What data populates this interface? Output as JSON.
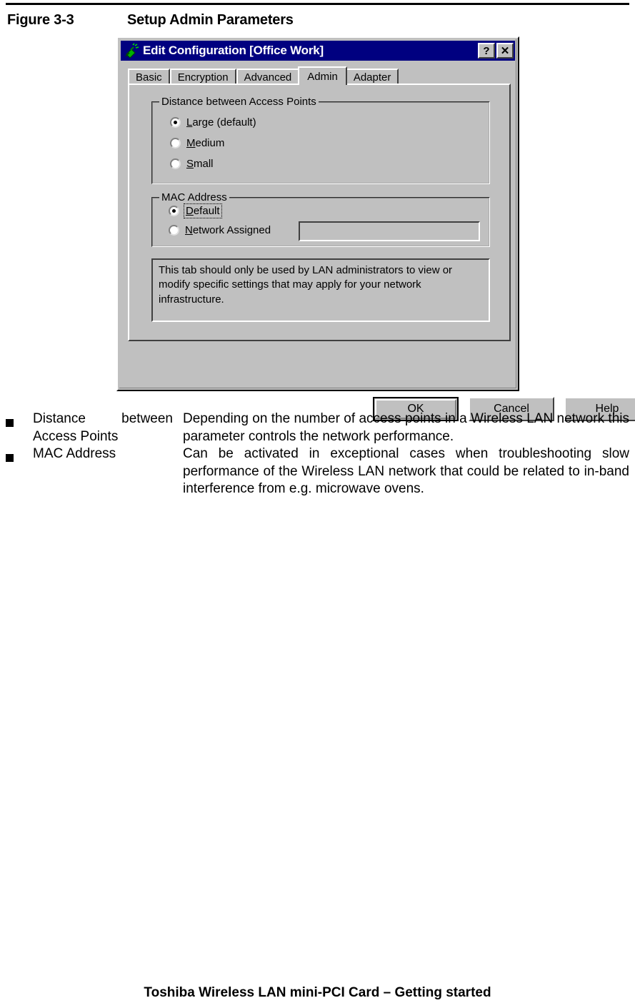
{
  "page": {
    "figure_number": "Figure 3-3",
    "figure_title": "Setup Admin Parameters",
    "footer": "Toshiba Wireless LAN mini-PCI Card – Getting started"
  },
  "dialog": {
    "title": "Edit Configuration [Office Work]",
    "icon": "wireless-antenna-icon",
    "titlebar_buttons": [
      {
        "name": "help-button",
        "glyph": "?"
      },
      {
        "name": "close-button",
        "glyph": "✕"
      }
    ],
    "tabs": [
      {
        "label": "Basic",
        "active": false
      },
      {
        "label": "Encryption",
        "active": false
      },
      {
        "label": "Advanced",
        "active": false
      },
      {
        "label": "Admin",
        "active": true
      },
      {
        "label": "Adapter",
        "active": false
      }
    ],
    "groups": [
      {
        "title": "Distance between Access Points",
        "options": [
          {
            "label_pre": "",
            "accel": "L",
            "label_post": "arge (default)",
            "checked": true,
            "focused": false
          },
          {
            "label_pre": "",
            "accel": "M",
            "label_post": "edium",
            "checked": false,
            "focused": false
          },
          {
            "label_pre": "",
            "accel": "S",
            "label_post": "mall",
            "checked": false,
            "focused": false
          }
        ]
      },
      {
        "title": "MAC Address",
        "options": [
          {
            "label_pre": "",
            "accel": "D",
            "label_post": "efault",
            "checked": true,
            "focused": true
          },
          {
            "label_pre": "",
            "accel": "N",
            "label_post": "etwork Assigned",
            "checked": false,
            "focused": false
          }
        ],
        "field": {
          "value": "",
          "placeholder": "",
          "enabled": false
        }
      }
    ],
    "info_text": "This tab should only be used by LAN administrators to view or modify specific settings that may apply for your network infrastructure.",
    "buttons": [
      {
        "label": "OK",
        "default": true
      },
      {
        "label": "Cancel",
        "default": false
      },
      {
        "label": "Help",
        "default": false
      }
    ]
  },
  "descriptions": [
    {
      "term_line1": "Distance between",
      "term_line2": "Access Points",
      "definition": "Depending on the number of access points in a Wireless LAN network this parameter controls the network performance."
    },
    {
      "term_line1": "MAC Address",
      "term_line2": "",
      "definition": "Can be activated in exceptional cases when troubleshooting slow performance of the Wireless LAN network that could be related to in-band interference from e.g. microwave ovens."
    }
  ]
}
